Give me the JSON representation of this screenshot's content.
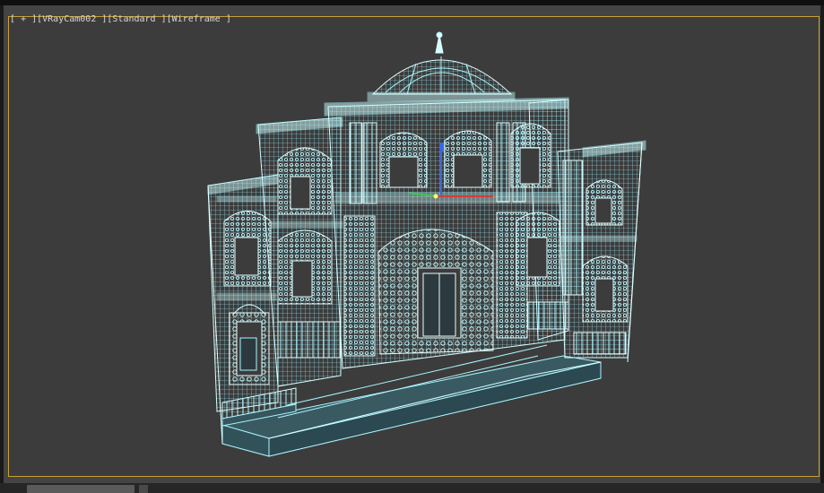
{
  "viewport": {
    "label_parts": {
      "plus": "[ + ]",
      "camera": "[VRayCam002 ]",
      "shading_standard": "[Standard ]",
      "mode": "[Wireframe ]"
    }
  },
  "colors": {
    "wire": "#a8f6ff",
    "wire_bright": "#e6ffff",
    "background": "#3c3c3c",
    "safe_frame": "#c8a037",
    "gizmo_x": "#d23c3c",
    "gizmo_y": "#3cc850",
    "gizmo_z": "#3c64e6"
  },
  "icons": {
    "gizmo": "transform-gizmo-icon"
  }
}
